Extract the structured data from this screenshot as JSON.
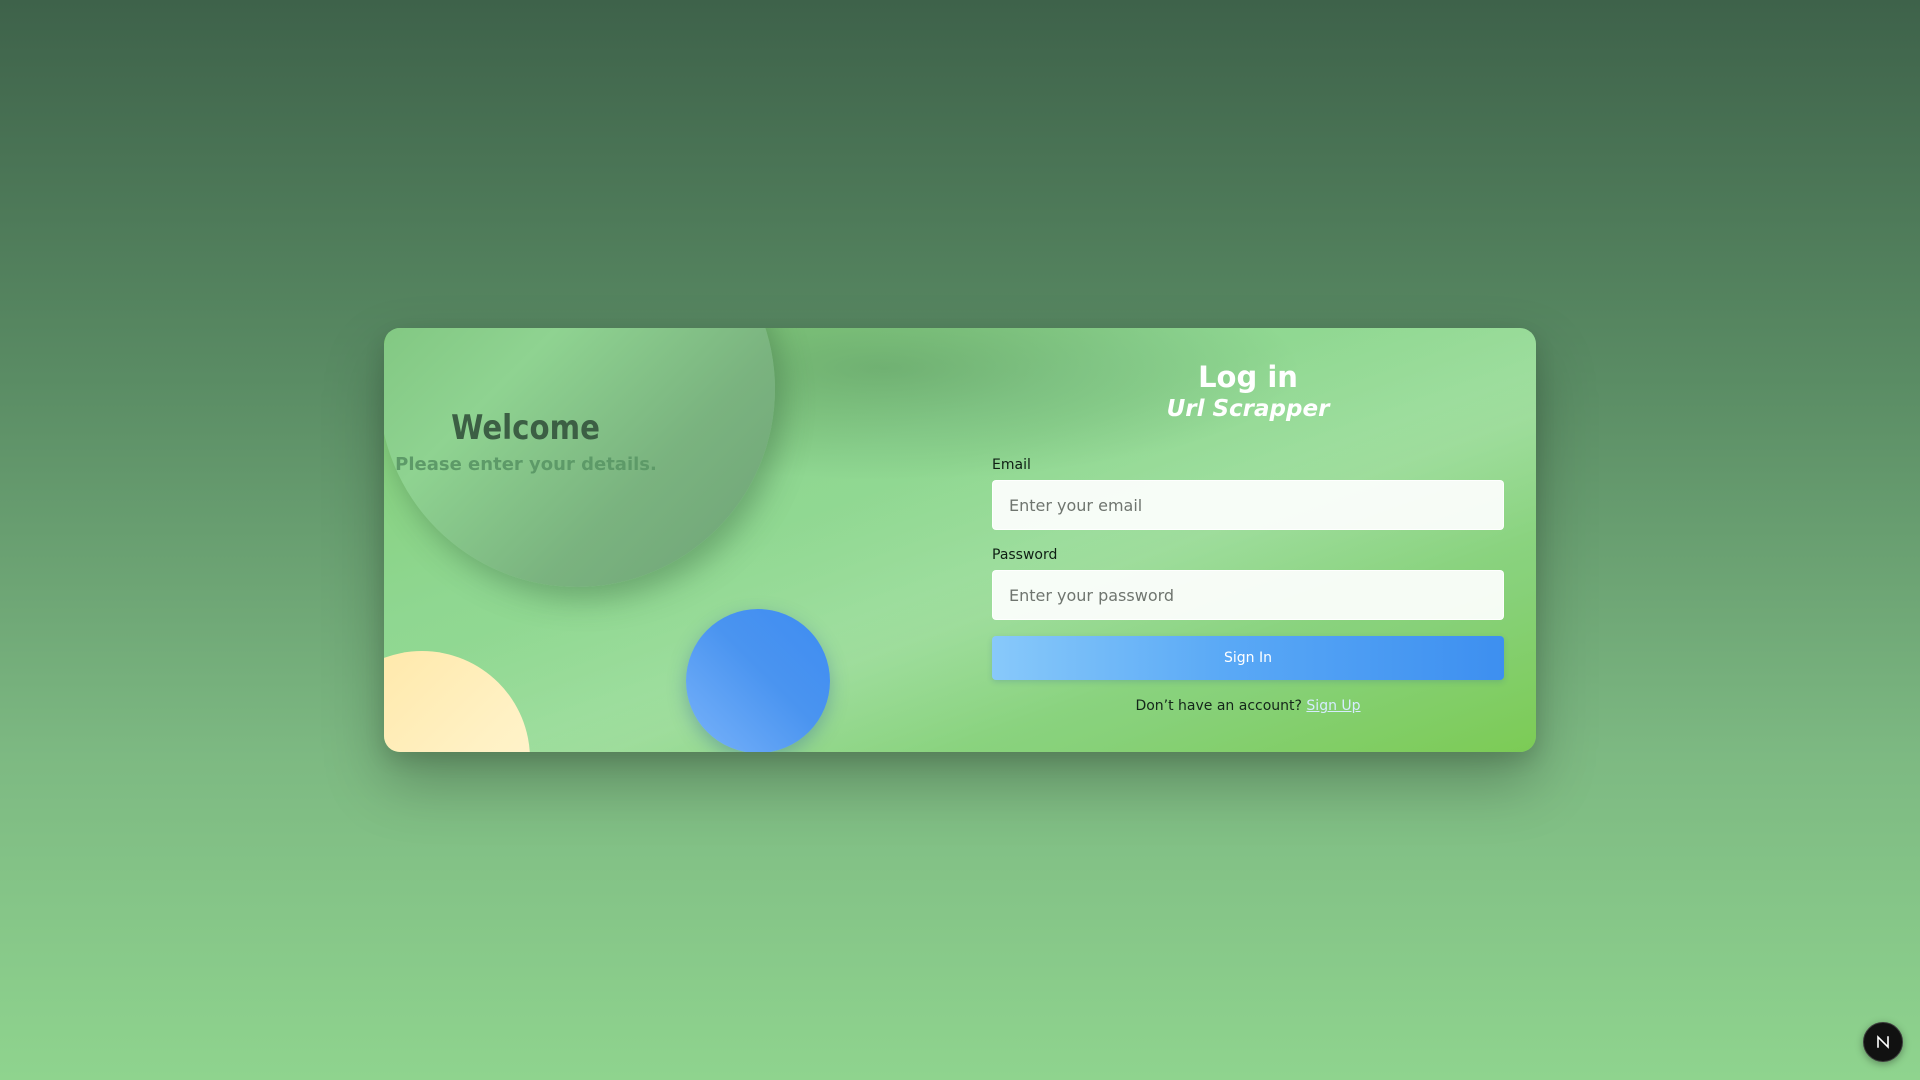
{
  "welcome": {
    "title": "Welcome",
    "subtitle": "Please enter your details."
  },
  "login": {
    "title": "Log in",
    "app_name": "Url Scrapper"
  },
  "form": {
    "email_label": "Email",
    "email_placeholder": "Enter your email",
    "email_value": "",
    "password_label": "Password",
    "password_placeholder": "Enter your password",
    "password_value": "",
    "submit_label": "Sign In"
  },
  "signup": {
    "prompt": "Don’t have an account?",
    "link_label": "Sign Up"
  },
  "badge": {
    "icon": "n-logo-icon"
  },
  "colors": {
    "page_top": "#3e624a",
    "page_bottom": "#8fd48e",
    "card": "#8fd791",
    "button_start": "#88c9fa",
    "button_end": "#3d8ff0",
    "accent_blue": "#4a94f0",
    "accent_yellow": "#fff1c4"
  }
}
